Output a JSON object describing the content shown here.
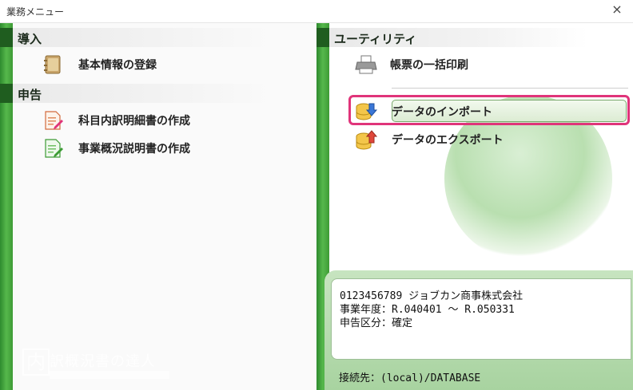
{
  "window": {
    "title": "業務メニュー",
    "close_symbol": "×"
  },
  "left": {
    "sections": [
      {
        "label": "導入"
      },
      {
        "label": "申告"
      }
    ],
    "items": [
      {
        "label": "基本情報の登録",
        "icon": "notebook-icon"
      },
      {
        "label": "科目内訳明細書の作成",
        "icon": "document-edit-icon"
      },
      {
        "label": "事業概況説明書の作成",
        "icon": "document-check-icon"
      }
    ],
    "logo": {
      "kanji": "内",
      "text": "訳概況書の達人"
    }
  },
  "right": {
    "section": {
      "label": "ユーティリティ"
    },
    "items": [
      {
        "label": "帳票の一括印刷",
        "icon": "printer-icon"
      },
      {
        "label": "データのインポート",
        "icon": "database-import-icon"
      },
      {
        "label": "データのエクスポート",
        "icon": "database-export-icon"
      }
    ],
    "info": {
      "line1": "0123456789 ジョブカン商事株式会社",
      "line2": "事業年度：R.040401 ～ R.050331",
      "line3": "申告区分：確定",
      "connection": "接続先：(local)/DATABASE"
    }
  },
  "colors": {
    "accent_green": "#3d9b35",
    "dark_green": "#1f5d1f",
    "highlight": "#e0347a"
  }
}
